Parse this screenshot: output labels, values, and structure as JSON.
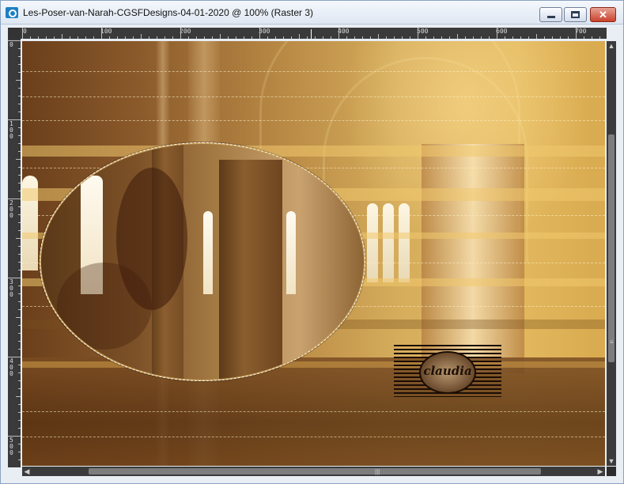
{
  "window": {
    "title": "Les-Poser-van-Narah-CGSFDesigns-04-01-2020 @ 100% (Raster 3)",
    "buttons": {
      "minimize_icon": "minimize-icon",
      "maximize_icon": "maximize-icon",
      "close_icon": "close-icon",
      "close_glyph": "✕"
    }
  },
  "ruler_top": {
    "labels": [
      "0",
      "100",
      "200",
      "300",
      "400",
      "500",
      "600",
      "700"
    ]
  },
  "ruler_left": {
    "labels": [
      "0",
      "100",
      "200",
      "300",
      "400",
      "500"
    ]
  },
  "canvas": {
    "watermark_text": "claudia",
    "colors": {
      "gold": "#d6ad5c",
      "brown": "#6a3f1b",
      "selection": "#ffffff"
    }
  },
  "scrollbars": {
    "horizontal_grip": "|||",
    "vertical_grip": "≡",
    "left_arrow": "◀",
    "right_arrow": "▶",
    "up_arrow": "▲",
    "down_arrow": "▼"
  }
}
